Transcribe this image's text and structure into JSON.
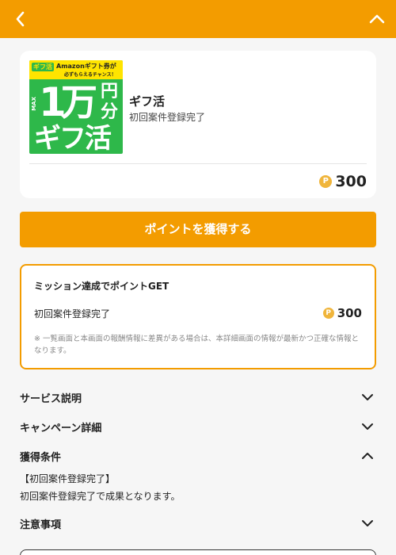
{
  "header": {
    "back_icon": "chevron-left-icon",
    "collapse_icon": "chevron-up-icon",
    "color": "#f39c00"
  },
  "offer": {
    "thumb": {
      "logo": "ギフ活",
      "banner_line1": "Amazonギフト券が",
      "banner_line2": "必ずもらえるチャンス！",
      "max": "MAX",
      "big1": "1",
      "big2": "万",
      "en": "円",
      "bun": "分",
      "big3": "ギフ活"
    },
    "title": "ギフ活",
    "subtitle": "初回案件登録完了",
    "coin_symbol": "P",
    "points": "300"
  },
  "get_button": {
    "label": "ポイントを獲得する"
  },
  "mission": {
    "title": "ミッション達成でポイントGET",
    "item_label": "初回案件登録完了",
    "coin_symbol": "P",
    "item_points": "300",
    "note": "※ 一覧画面と本画面の報酬情報に差異がある場合は、本詳細画面の情報が最新かつ正確な情報となります。"
  },
  "sections": {
    "service": {
      "label": "サービス説明",
      "state": "collapsed"
    },
    "campaign": {
      "label": "キャンペーン詳細",
      "state": "collapsed"
    },
    "conditions": {
      "label": "獲得条件",
      "state": "expanded",
      "line1": "【初回案件登録完了】",
      "line2": "初回案件登録完了で成果となります。"
    },
    "notes": {
      "label": "注意事項",
      "state": "collapsed"
    }
  },
  "colors": {
    "accent": "#f39c00",
    "coin": "#f0b53b",
    "thumb_green": "#2eb84a",
    "thumb_yellow": "#ffe400"
  }
}
